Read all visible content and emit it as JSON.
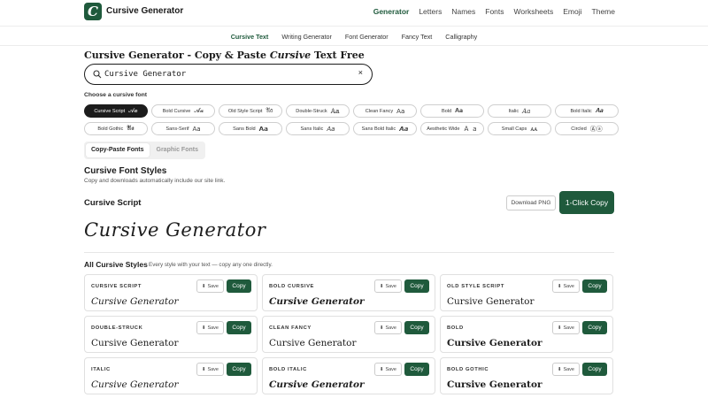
{
  "header": {
    "logo_letter": "C",
    "brand": "Cursive Generator",
    "nav": [
      "Generator",
      "Letters",
      "Names",
      "Fonts",
      "Worksheets",
      "Emoji",
      "Theme"
    ],
    "active_nav": "Generator"
  },
  "subnav": {
    "items": [
      "Cursive Text",
      "Writing Generator",
      "Font Generator",
      "Fancy Text",
      "Calligraphy"
    ],
    "active": "Cursive Text"
  },
  "page": {
    "title_prefix": "Cursive Generator - Copy & Paste ",
    "title_cursive": "Cursive",
    "title_suffix": " Text Free"
  },
  "search": {
    "value": "Cursive Generator",
    "clear_icon": "×"
  },
  "choose_label": "Choose a cursive font",
  "font_chips": [
    {
      "label": "Cursive Script",
      "glyph": "𝒜𝒶",
      "active": true
    },
    {
      "label": "Bold Cursive",
      "glyph": "𝓐𝓪"
    },
    {
      "label": "Old Style Script",
      "glyph": "𝔄𝔞"
    },
    {
      "label": "Double-Struck",
      "glyph": "𝔸𝕒"
    },
    {
      "label": "Clean Fancy",
      "glyph": "𝖠𝖺"
    },
    {
      "label": "Bold",
      "glyph": "𝐀𝐚"
    },
    {
      "label": "Italic",
      "glyph": "𝐴𝑎"
    },
    {
      "label": "Bold Italic",
      "glyph": "𝑨𝒂"
    },
    {
      "label": "Bold Gothic",
      "glyph": "𝕬𝖆"
    },
    {
      "label": "Sans-Serif",
      "glyph": "𝖠𝖺"
    },
    {
      "label": "Sans Bold",
      "glyph": "𝗔𝗮"
    },
    {
      "label": "Sans Italic",
      "glyph": "𝘈𝘢"
    },
    {
      "label": "Sans Bold Italic",
      "glyph": "𝘼𝙖"
    },
    {
      "label": "Aesthetic Wide",
      "glyph": "Ａ ａ"
    },
    {
      "label": "Small Caps",
      "glyph": "ᴀᴀ"
    },
    {
      "label": "Circled",
      "glyph": "Ⓐⓐ"
    }
  ],
  "tabs": {
    "copy_paste": "Copy-Paste Fonts",
    "graphic": "Graphic Fonts"
  },
  "styles_section": {
    "title": "Cursive Font Styles",
    "subtitle": "Copy and downloads automatically include our site link."
  },
  "current": {
    "style_name": "Cursive Script",
    "download_label": "Download PNG",
    "copy_label": "1-Click Copy",
    "preview": "Cursive Generator"
  },
  "all_styles": {
    "title": "All Cursive Styles",
    "subtitle": "Every style with your text — copy any one directly.",
    "save_label": "Save",
    "copy_label": "Copy",
    "cards": [
      {
        "name": "CURSIVE SCRIPT",
        "sample": "Cursive Generator",
        "style": "s-italic"
      },
      {
        "name": "BOLD CURSIVE",
        "sample": "Cursive Generator",
        "style": "s-bolditalic"
      },
      {
        "name": "OLD STYLE SCRIPT",
        "sample": "Cursive Generator",
        "style": "s-plain"
      },
      {
        "name": "DOUBLE-STRUCK",
        "sample": "Cursive Generator",
        "style": "s-plain"
      },
      {
        "name": "CLEAN FANCY",
        "sample": "Cursive Generator",
        "style": "s-plain"
      },
      {
        "name": "BOLD",
        "sample": "Cursive Generator",
        "style": "s-bold"
      },
      {
        "name": "ITALIC",
        "sample": "Cursive Generator",
        "style": "s-italic"
      },
      {
        "name": "BOLD ITALIC",
        "sample": "Cursive Generator",
        "style": "s-bolditalic"
      },
      {
        "name": "BOLD GOTHIC",
        "sample": "Cursive Generator",
        "style": "s-bold"
      }
    ]
  },
  "colors": {
    "accent": "#1f5a3c",
    "dark": "#1c1c1c"
  }
}
